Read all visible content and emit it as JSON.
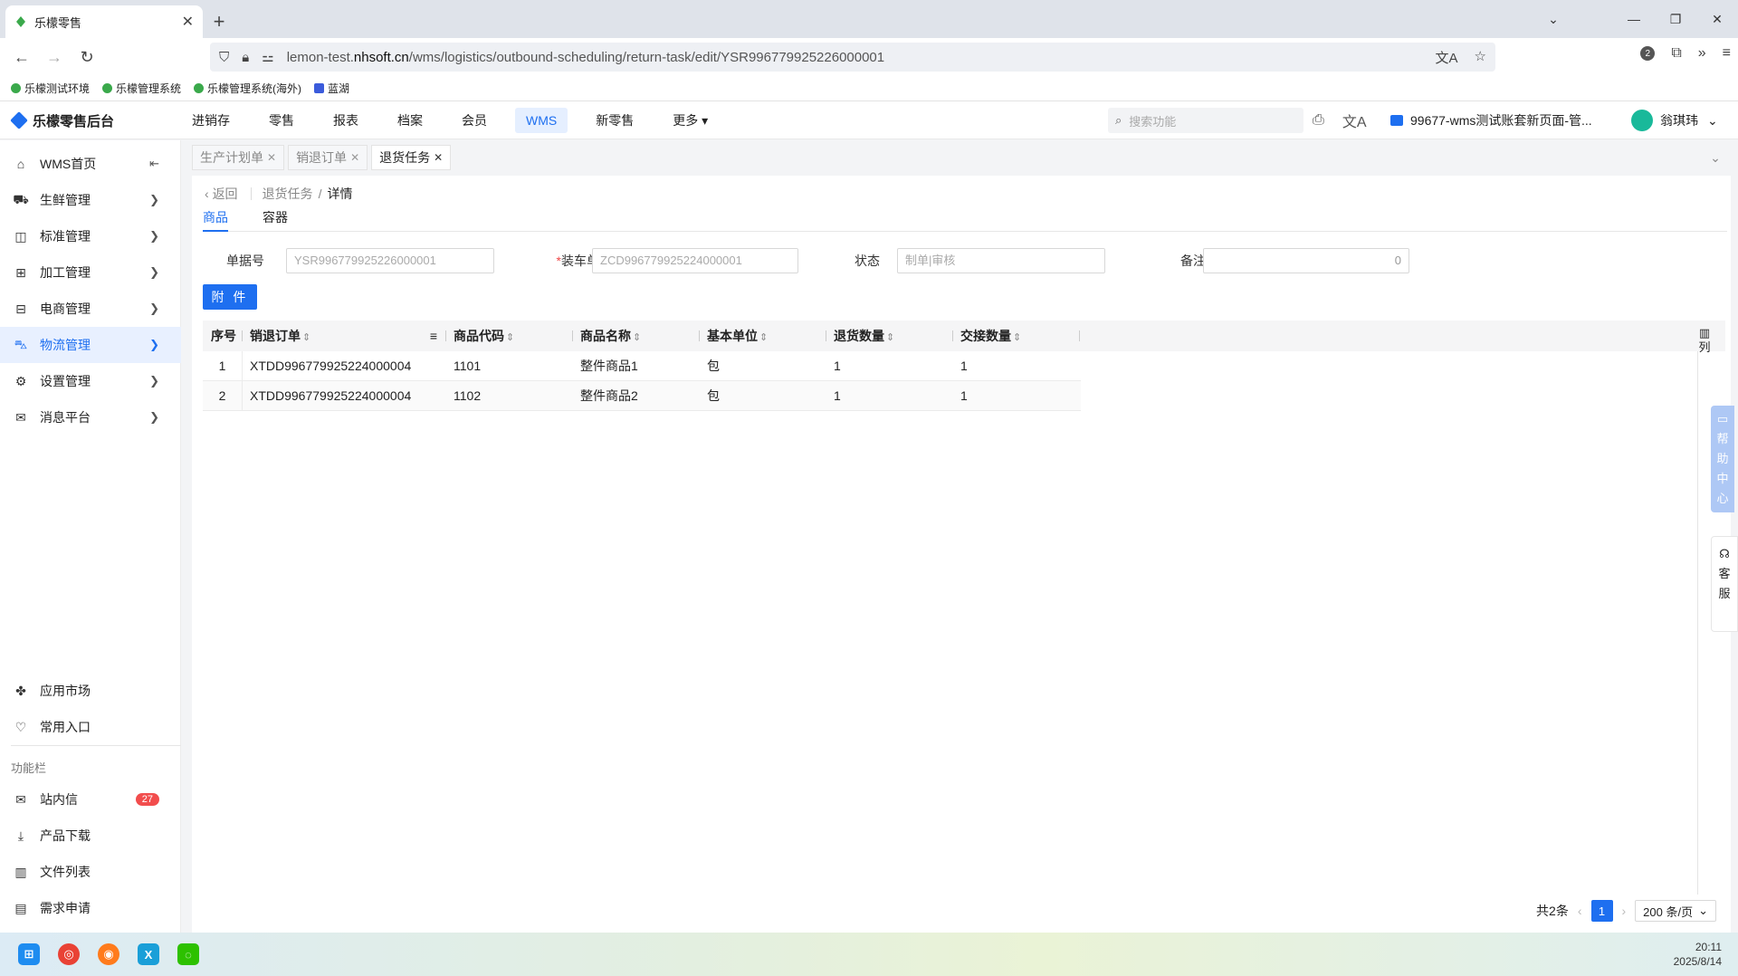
{
  "browser": {
    "tab_title": "乐檬零售",
    "url_prefix": "lemon-test.",
    "url_domain": "nhsoft.cn",
    "url_path": "/wms/logistics/outbound-scheduling/return-task/edit/YSR996779925226000001",
    "extensions_badge": "2",
    "bookmarks": [
      "乐檬测试环境",
      "乐檬管理系统",
      "乐檬管理系统(海外)",
      "蓝湖"
    ]
  },
  "app": {
    "logo_text": "乐檬零售后台",
    "top_menu": [
      "进销存",
      "零售",
      "报表",
      "档案",
      "会员",
      "WMS",
      "新零售",
      "更多"
    ],
    "active_menu": "WMS",
    "search_placeholder": "搜索功能",
    "account": "99677-wms测试账套新页面-管...",
    "username": "翁琪玮"
  },
  "sidebar": {
    "items": [
      {
        "label": "WMS首页",
        "icon": "home-icon"
      },
      {
        "label": "生鲜管理",
        "icon": "basket-icon"
      },
      {
        "label": "标准管理",
        "icon": "box-icon"
      },
      {
        "label": "加工管理",
        "icon": "factory-icon"
      },
      {
        "label": "电商管理",
        "icon": "shop-icon"
      },
      {
        "label": "物流管理",
        "icon": "truck-icon"
      },
      {
        "label": "设置管理",
        "icon": "settings-icon"
      },
      {
        "label": "消息平台",
        "icon": "message-icon"
      }
    ],
    "bottom": [
      {
        "label": "应用市场",
        "icon": "app-market-icon"
      },
      {
        "label": "常用入口",
        "icon": "heart-icon"
      }
    ],
    "caption": "功能栏",
    "tools": [
      {
        "label": "站内信",
        "icon": "mail-icon",
        "badge": "27"
      },
      {
        "label": "产品下载",
        "icon": "download-icon"
      },
      {
        "label": "文件列表",
        "icon": "file-list-icon"
      },
      {
        "label": "需求申请",
        "icon": "request-icon"
      }
    ]
  },
  "page_tabs": [
    {
      "label": "生产计划单"
    },
    {
      "label": "销退订单"
    },
    {
      "label": "退货任务"
    }
  ],
  "breadcrumb": {
    "back": "返回",
    "parent": "退货任务",
    "current": "详情"
  },
  "sub_tabs": [
    "商品",
    "容器"
  ],
  "form": {
    "doc_no_label": "单据号",
    "doc_no_value": "YSR996779925226000001",
    "load_label": "装车单",
    "load_value": "ZCD996779925224000001",
    "status_label": "状态",
    "status_placeholder": "制单|审核",
    "remark_label": "备注",
    "remark_value": "0"
  },
  "attach_label": "附 件",
  "table": {
    "columns": [
      "序号",
      "销退订单",
      "商品代码",
      "商品名称",
      "基本单位",
      "退货数量",
      "交接数量"
    ],
    "rows": [
      {
        "seq": "1",
        "order": "XTDD996779925224000004",
        "code": "1101",
        "name": "整件商品1",
        "unit": "包",
        "return_qty": "1",
        "handover_qty": "1"
      },
      {
        "seq": "2",
        "order": "XTDD996779925224000004",
        "code": "1102",
        "name": "整件商品2",
        "unit": "包",
        "return_qty": "1",
        "handover_qty": "1"
      }
    ],
    "col_setting": "列"
  },
  "pager": {
    "total": "共2条",
    "page": "1",
    "size": "200 条/页"
  },
  "floats": {
    "help": [
      "帮",
      "助",
      "中",
      "心"
    ],
    "service": [
      "客",
      "服"
    ]
  },
  "clock": {
    "time": "20:11",
    "date": "2025/8/14"
  }
}
